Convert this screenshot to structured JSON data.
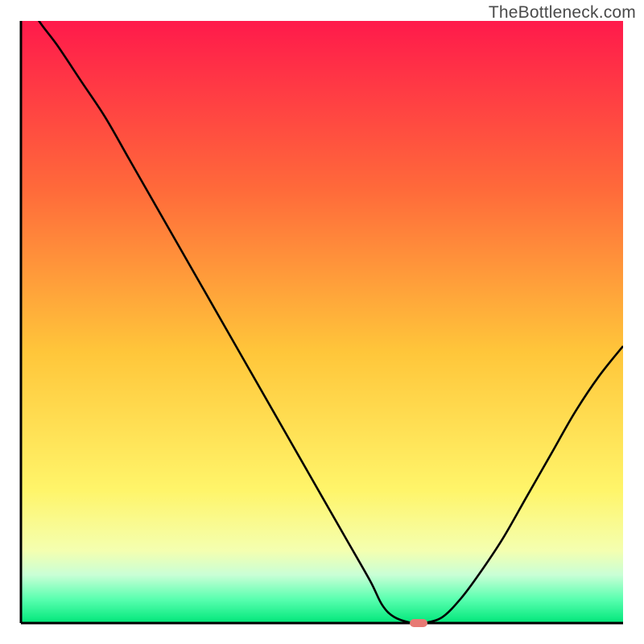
{
  "watermark": "TheBottleneck.com",
  "colors": {
    "gradient_top": "#ff1a4b",
    "gradient_upper_mid": "#ff7a3a",
    "gradient_mid": "#ffd23a",
    "gradient_lower_mid": "#faff8a",
    "gradient_green_band_top": "#b7ffce",
    "gradient_green": "#00e77a",
    "curve_stroke": "#000000",
    "axis": "#000000",
    "marker": "#e77a74"
  },
  "chart_data": {
    "type": "line",
    "title": "",
    "xlabel": "",
    "ylabel": "",
    "xlim": [
      0,
      100
    ],
    "ylim": [
      0,
      100
    ],
    "x": [
      0,
      3,
      6,
      10,
      14,
      18,
      22,
      26,
      30,
      34,
      38,
      42,
      46,
      50,
      54,
      58,
      60,
      62,
      65,
      67,
      70,
      73,
      76,
      80,
      84,
      88,
      92,
      96,
      100
    ],
    "values": [
      105,
      100,
      96,
      90,
      84,
      77,
      70,
      63,
      56,
      49,
      42,
      35,
      28,
      21,
      14,
      7,
      3,
      1,
      0,
      0,
      1,
      4,
      8,
      14,
      21,
      28,
      35,
      41,
      46
    ],
    "minimum_marker_x": 66,
    "minimum_marker_y": 0
  }
}
